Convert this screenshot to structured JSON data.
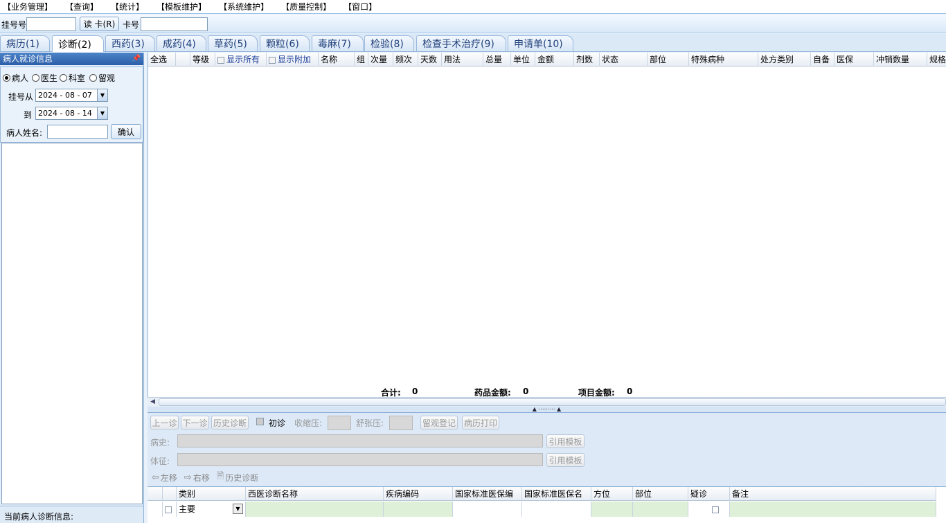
{
  "menu": [
    "【业务管理】",
    "【查询】",
    "【统计】",
    "【模板维护】",
    "【系统维护】",
    "【质量控制】",
    "【窗口】"
  ],
  "regbar": {
    "reg_label": "挂号号",
    "read_card": "读 卡(R)",
    "card_label": "卡号"
  },
  "tabs": [
    "病历(1)",
    "诊断(2)",
    "西药(3)",
    "成药(4)",
    "草药(5)",
    "颗粒(6)",
    "毒麻(7)",
    "检验(8)",
    "检查手术治疗(9)",
    "申请单(10)"
  ],
  "active_tab": "诊断(2)",
  "left": {
    "title": "病人就诊信息",
    "pin_icon": "pin-icon",
    "radios": [
      "病人",
      "医生",
      "科室",
      "留观"
    ],
    "from_label": "挂号从",
    "to_label": "到",
    "date_from": "2024 - 08 - 07",
    "date_to": "2024 - 08 - 14",
    "name_label": "病人姓名:",
    "confirm": "确认",
    "status": "当前病人诊断信息:"
  },
  "grid": {
    "columns": [
      "全选",
      "",
      "等级",
      "显示所有",
      "显示附加",
      "名称",
      "组",
      "次量",
      "频次",
      "天数",
      "用法",
      "总量",
      "单位",
      "金额",
      "剂数",
      "状态",
      "部位",
      "特殊病种",
      "处方类别",
      "自备",
      "医保",
      "冲销数量",
      "规格"
    ],
    "total_label": "合计:",
    "total_value": "0",
    "drug_label": "药品金额:",
    "drug_value": "0",
    "item_label": "项目金额:",
    "item_value": "0"
  },
  "lower": {
    "prev": "上一诊",
    "next": "下一诊",
    "history": "历史诊断",
    "first_visit": "初诊",
    "systolic": "收缩压:",
    "diastolic": "舒张压:",
    "observe": "留观登记",
    "print": "病历打印",
    "history_label": "病史:",
    "sign_label": "体征:",
    "cite": "引用模板",
    "toolbar": {
      "left": "左移",
      "right": "右移",
      "hist": "历史诊断"
    },
    "diag_columns": [
      "类别",
      "西医诊断名称",
      "疾病编码",
      "国家标准医保编",
      "国家标准医保名",
      "方位",
      "部位",
      "疑诊",
      "备注"
    ],
    "row_type": "主要"
  }
}
